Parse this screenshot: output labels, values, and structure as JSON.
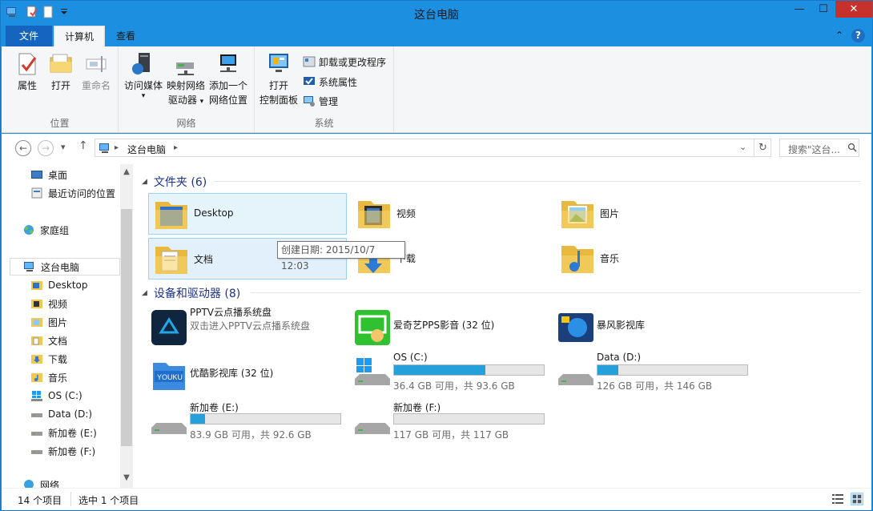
{
  "window": {
    "title": "这台电脑"
  },
  "tabs": {
    "file": "文件",
    "computer": "计算机",
    "view": "查看"
  },
  "ribbon": {
    "groups": {
      "location": "位置",
      "network": "网络",
      "system": "系统"
    },
    "location": {
      "properties": "属性",
      "open": "打开",
      "rename": "重命名"
    },
    "network": {
      "access_media_1": "访问媒体",
      "map_drive_1": "映射网络",
      "map_drive_2": "驱动器",
      "add_location_1": "添加一个",
      "add_location_2": "网络位置"
    },
    "system": {
      "open_cp_1": "打开",
      "open_cp_2": "控制面板",
      "uninstall": "卸载或更改程序",
      "sys_props": "系统属性",
      "manage": "管理"
    }
  },
  "address": {
    "crumb": "这台电脑",
    "search_placeholder": "搜索\"这台..."
  },
  "nav": {
    "items": [
      "桌面",
      "最近访问的位置",
      "家庭组",
      "这台电脑",
      "Desktop",
      "视频",
      "图片",
      "文档",
      "下载",
      "音乐",
      "OS (C:)",
      "Data (D:)",
      "新加卷 (E:)",
      "新加卷 (F:)",
      "网络"
    ]
  },
  "folders_header": "文件夹 (6)",
  "folders": [
    "Desktop",
    "视频",
    "图片",
    "文档",
    "下载",
    "音乐"
  ],
  "tooltip": "创建日期: 2015/10/7 12:03",
  "devices_header": "设备和驱动器 (8)",
  "devices": {
    "pptv": {
      "name": "PPTV云点播系统盘",
      "sub": "双击进入PPTV云点播系统盘"
    },
    "iqiyi": {
      "name": "爱奇艺PPS影音 (32 位)"
    },
    "baofeng": {
      "name": "暴风影视库"
    },
    "youku": {
      "name": "优酷影视库 (32 位)"
    },
    "c": {
      "name": "OS (C:)",
      "free": "36.4 GB 可用，共 93.6 GB",
      "used_fraction": 0.61
    },
    "d": {
      "name": "Data (D:)",
      "free": "126 GB 可用，共 146 GB",
      "used_fraction": 0.137
    },
    "e": {
      "name": "新加卷 (E:)",
      "free": "83.9 GB 可用，共 92.6 GB",
      "used_fraction": 0.094
    },
    "f": {
      "name": "新加卷 (F:)",
      "free": "117 GB 可用，共 117 GB",
      "used_fraction": 0.0
    }
  },
  "status": {
    "items": "14 个项目",
    "selected": "选中 1 个项目"
  },
  "colors": {
    "accent": "#1c8fe0",
    "close": "#c7312b",
    "drive_fill": "#26a0da",
    "group_header": "#1e3287"
  }
}
